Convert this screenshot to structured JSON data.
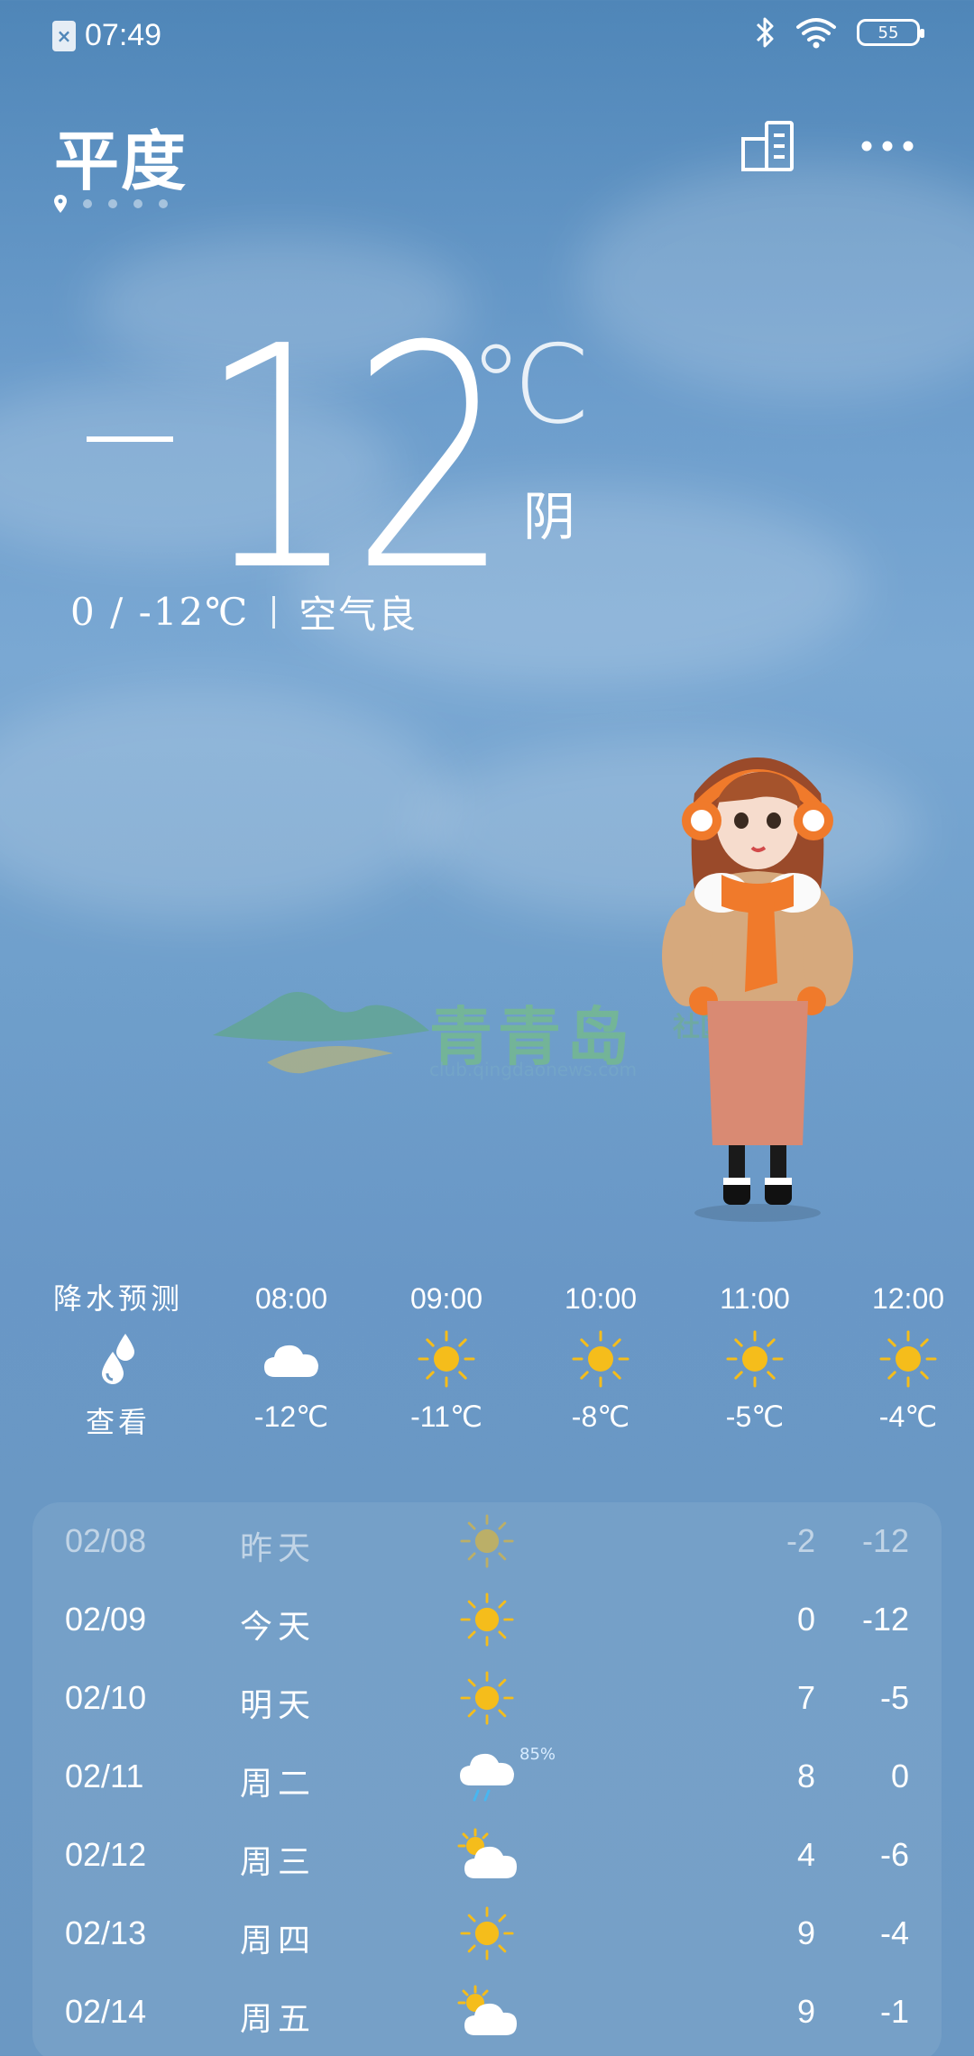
{
  "status_bar": {
    "time": "07:49",
    "battery": "55",
    "sim_icon": "sim-off-icon",
    "bluetooth_icon": "bluetooth-icon",
    "wifi_icon": "wifi-icon"
  },
  "header": {
    "city": "平度",
    "location_icon": "location-pin-icon",
    "city_list_icon": "city-list-icon",
    "more_icon": "more-icon"
  },
  "current": {
    "temp_minus": "−",
    "temp_value": "12",
    "unit": "℃",
    "condition": "阴",
    "high_low": "0 / -12℃",
    "air_quality": "空气良"
  },
  "watermark": {
    "text": "青青岛",
    "sub": "club.qingdaonews.com",
    "suffix": "社区"
  },
  "hourly": {
    "precip_title": "降水预测",
    "precip_link": "查看",
    "hours": [
      {
        "time": "08:00",
        "icon": "cloud-icon",
        "temp": "-12℃"
      },
      {
        "time": "09:00",
        "icon": "sun-icon",
        "temp": "-11℃"
      },
      {
        "time": "10:00",
        "icon": "sun-icon",
        "temp": "-8℃"
      },
      {
        "time": "11:00",
        "icon": "sun-icon",
        "temp": "-5℃"
      },
      {
        "time": "12:00",
        "icon": "sun-icon",
        "temp": "-4℃"
      }
    ]
  },
  "daily": [
    {
      "date": "02/08",
      "day": "昨天",
      "icon": "sun-icon",
      "hi": "-2",
      "lo": "-12"
    },
    {
      "date": "02/09",
      "day": "今天",
      "icon": "sun-icon",
      "hi": "0",
      "lo": "-12"
    },
    {
      "date": "02/10",
      "day": "明天",
      "icon": "sun-icon",
      "hi": "7",
      "lo": "-5"
    },
    {
      "date": "02/11",
      "day": "周二",
      "icon": "rain-cloud-icon",
      "prob": "85%",
      "hi": "8",
      "lo": "0"
    },
    {
      "date": "02/12",
      "day": "周三",
      "icon": "partly-cloudy-icon",
      "hi": "4",
      "lo": "-6"
    },
    {
      "date": "02/13",
      "day": "周四",
      "icon": "sun-icon",
      "hi": "9",
      "lo": "-4"
    },
    {
      "date": "02/14",
      "day": "周五",
      "icon": "partly-cloudy-icon",
      "hi": "9",
      "lo": "-1"
    }
  ],
  "colors": {
    "sun": "#f5bd1b",
    "sky_top": "#4f86b8",
    "sky_bottom": "#6b98c3"
  }
}
